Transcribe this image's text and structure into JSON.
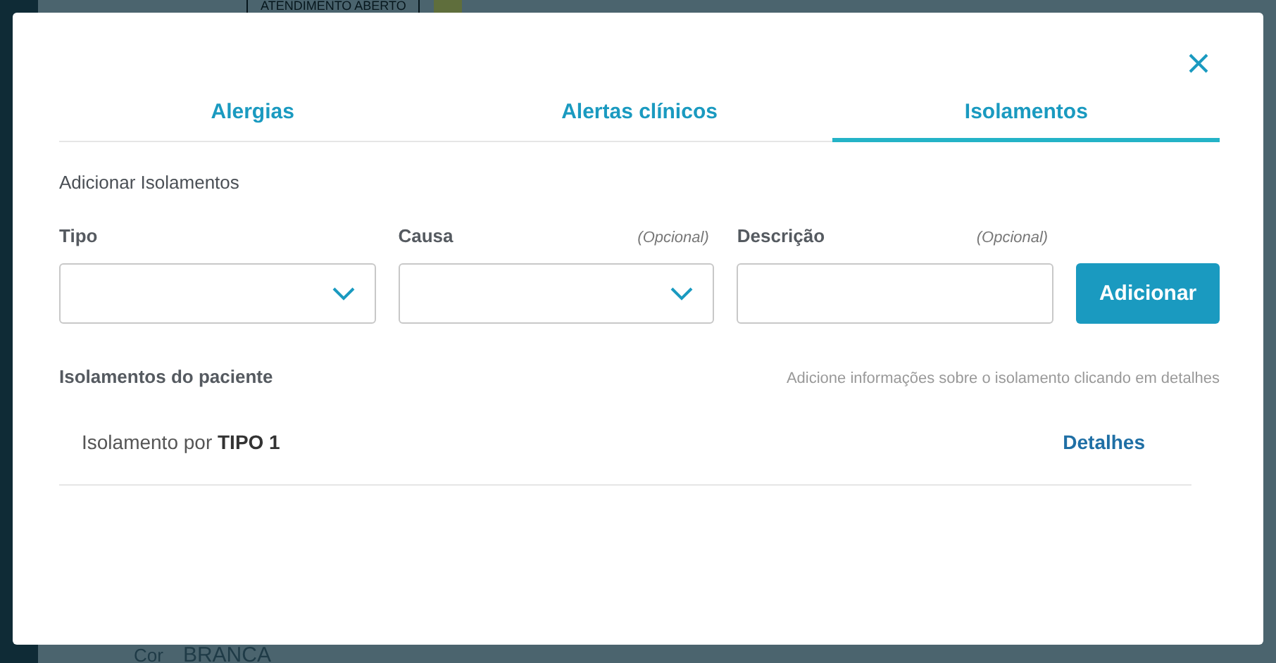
{
  "background": {
    "status": "ATENDIMENTO ABERTO",
    "field_label": "Cor",
    "field_value": "BRANCA"
  },
  "tabs": [
    {
      "label": "Alergias",
      "selected": false
    },
    {
      "label": "Alertas clínicos",
      "selected": false
    },
    {
      "label": "Isolamentos",
      "selected": true
    }
  ],
  "section_title": "Adicionar Isolamentos",
  "fields": [
    {
      "kind": "select",
      "label": "Tipo"
    },
    {
      "kind": "select",
      "label": "Causa",
      "hint": "(Opcional)"
    },
    {
      "kind": "text",
      "label": "Descrição",
      "hint": "(Opcional)"
    }
  ],
  "add_button": "Adicionar",
  "list": {
    "title": "Isolamentos do paciente",
    "hint": "Adicione informações sobre o isolamento clicando em detalhes",
    "rows": [
      {
        "text": "Isolamento por **TIPO 1**",
        "action": "Detalhes"
      }
    ]
  }
}
